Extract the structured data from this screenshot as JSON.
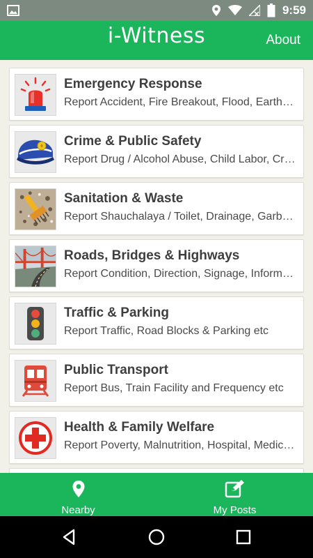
{
  "status_bar": {
    "time": "9:59"
  },
  "app_bar": {
    "logo": "i-Witness",
    "about_label": "About"
  },
  "categories": [
    {
      "title": "Emergency Response",
      "subtitle": "Report Accident, Fire Breakout, Flood, Earthquake etc",
      "icon": "siren-icon"
    },
    {
      "title": "Crime & Public Safety",
      "subtitle": "Report Drug / Alcohol Abuse, Child Labor, Crime etc",
      "icon": "police-cap-icon"
    },
    {
      "title": "Sanitation & Waste",
      "subtitle": "Report Shauchalaya / Toilet, Drainage, Garbage etc",
      "icon": "cleaning-brush-icon"
    },
    {
      "title": "Roads, Bridges & Highways",
      "subtitle": "Report Condition, Direction, Signage, Information etc",
      "icon": "bridge-road-icon"
    },
    {
      "title": "Traffic & Parking",
      "subtitle": "Report Traffic, Road Blocks & Parking etc",
      "icon": "traffic-light-icon"
    },
    {
      "title": "Public Transport",
      "subtitle": "Report Bus, Train Facility and Frequency etc",
      "icon": "train-icon"
    },
    {
      "title": "Health & Family Welfare",
      "subtitle": "Report Poverty, Malnutrition, Hospital, Medicine etc",
      "icon": "medical-cross-icon"
    }
  ],
  "bottom_nav": {
    "nearby_label": "Nearby",
    "my_posts_label": "My Posts"
  }
}
